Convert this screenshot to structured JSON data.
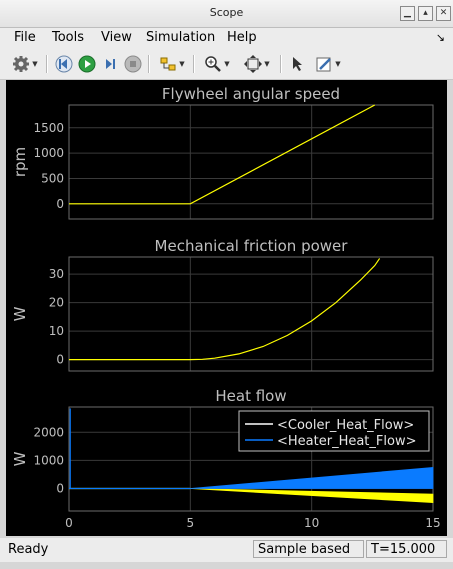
{
  "window": {
    "title": "Scope"
  },
  "menu": {
    "items": [
      "File",
      "Tools",
      "View",
      "Simulation",
      "Help"
    ]
  },
  "toolbar": {
    "icons": [
      "gear-icon",
      "step-back-icon",
      "run-icon",
      "step-forward-icon",
      "stop-icon",
      "highlight-icon",
      "zoom-icon",
      "fit-to-view-icon",
      "cursor-measure-icon",
      "style-icon"
    ]
  },
  "status": {
    "state": "Ready",
    "mode": "Sample based",
    "time": "T=15.000"
  },
  "colors": {
    "plot_bg": "#000000",
    "axes_fg": "#bfbfbf",
    "grid": "#3a3a3a",
    "series_yellow": "#ffff00",
    "series_blue": "#0a7bff"
  },
  "chart_data": [
    {
      "type": "line",
      "title": "Flywheel angular speed",
      "ylabel": "rpm",
      "xlim": [
        0,
        15
      ],
      "ylim": [
        -300,
        1950
      ],
      "yticks": [
        0,
        500,
        1000,
        1500
      ],
      "xticks": [
        0,
        5,
        10,
        15
      ],
      "grid": true,
      "series": [
        {
          "color": "#ffff00",
          "x": [
            0,
            5,
            12.6
          ],
          "y": [
            0,
            0,
            1950
          ]
        }
      ]
    },
    {
      "type": "line",
      "title": "Mechanical friction power",
      "ylabel": "W",
      "xlim": [
        0,
        15
      ],
      "ylim": [
        -4,
        36
      ],
      "yticks": [
        0,
        10,
        20,
        30
      ],
      "xticks": [
        0,
        5,
        10,
        15
      ],
      "grid": true,
      "series": [
        {
          "color": "#ffff00",
          "x": [
            0,
            5,
            5.5,
            6,
            7,
            8,
            9,
            10,
            11,
            12,
            12.6,
            12.8
          ],
          "y": [
            0,
            0,
            0.1,
            0.5,
            2,
            4.6,
            8.5,
            13.6,
            20,
            27.8,
            33,
            35.5
          ]
        }
      ]
    },
    {
      "type": "line",
      "title": "Heat flow",
      "ylabel": "W",
      "xlabel": "",
      "xlim": [
        0,
        15
      ],
      "ylim": [
        -800,
        2900
      ],
      "yticks": [
        0,
        1000,
        2000
      ],
      "xticks": [
        0,
        5,
        10,
        15
      ],
      "xticklabels": [
        "0",
        "5",
        "10",
        "15"
      ],
      "grid": true,
      "legend": {
        "placement": "top-right",
        "entries": [
          "<Cooler_Heat_Flow>",
          "<Heater_Heat_Flow>"
        ]
      },
      "series": [
        {
          "name": "<Cooler_Heat_Flow>",
          "color": "#ffff00",
          "envelope": {
            "x": [
              0,
              5,
              15
            ],
            "upper": [
              0,
              0,
              -200
            ],
            "lower": [
              0,
              0,
              -500
            ]
          }
        },
        {
          "name": "<Heater_Heat_Flow>",
          "color": "#0a7bff",
          "spike": {
            "x": 0.05,
            "peak": 2850
          },
          "envelope": {
            "x": [
              0,
              5,
              15
            ],
            "upper": [
              0,
              0,
              750
            ],
            "lower": [
              0,
              0,
              0
            ]
          }
        }
      ]
    }
  ]
}
